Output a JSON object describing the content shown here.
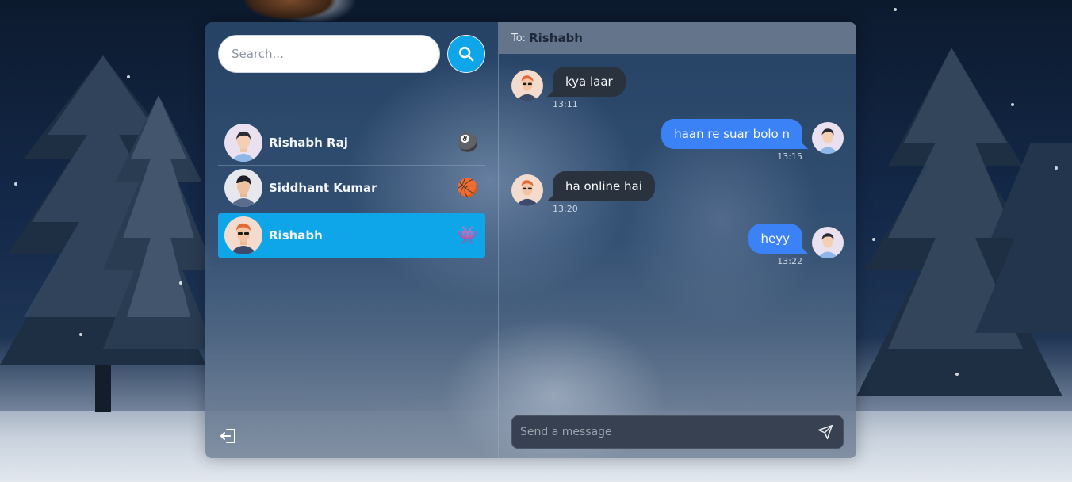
{
  "search": {
    "placeholder": "Search..."
  },
  "contacts": [
    {
      "name": "Rishabh Raj",
      "emoji": "🎱",
      "active": false
    },
    {
      "name": "Siddhant Kumar",
      "emoji": "🏀",
      "active": false
    },
    {
      "name": "Rishabh",
      "emoji": "👾",
      "active": true
    }
  ],
  "chat": {
    "to_label": "To:",
    "to_name": "Rishabh",
    "messages": [
      {
        "direction": "in",
        "text": "kya laar",
        "time": "13:11"
      },
      {
        "direction": "out",
        "text": "haan re suar bolo n",
        "time": "13:15"
      },
      {
        "direction": "in",
        "text": "ha online hai",
        "time": "13:20"
      },
      {
        "direction": "out",
        "text": "heyy",
        "time": "13:22"
      }
    ],
    "composer_placeholder": "Send a message"
  },
  "colors": {
    "accent": "#0ea5e9",
    "outgoing_bubble": "#3b82f6",
    "incoming_bubble": "#2a323d",
    "header": "#64748b"
  },
  "icons": {
    "search": "search-icon",
    "logout": "logout-icon",
    "send": "send-icon"
  }
}
